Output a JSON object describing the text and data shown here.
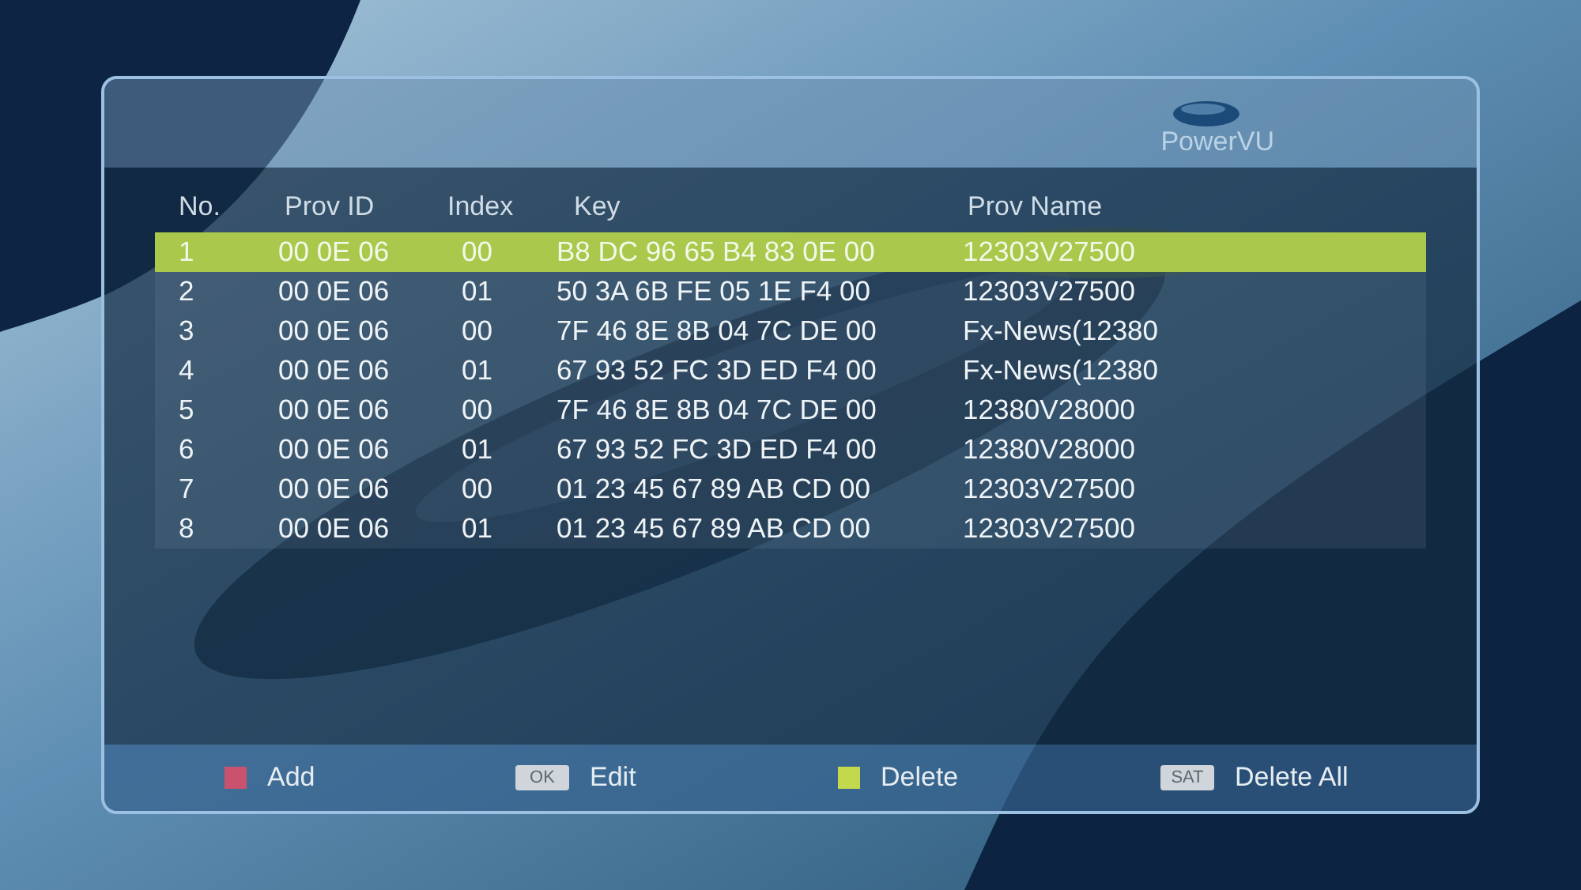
{
  "screen": {
    "title": "PowerVU"
  },
  "table": {
    "columns": [
      "No.",
      "Prov ID",
      "Index",
      "Key",
      "Prov Name"
    ],
    "rows": [
      {
        "no": "1",
        "prov_id": "00 0E 06",
        "index": "00",
        "key": "B8 DC 96 65 B4 83 0E 00",
        "prov_name": "12303V27500",
        "selected": true
      },
      {
        "no": "2",
        "prov_id": "00 0E 06",
        "index": "01",
        "key": "50 3A 6B FE 05 1E F4 00",
        "prov_name": "12303V27500",
        "selected": false
      },
      {
        "no": "3",
        "prov_id": "00 0E 06",
        "index": "00",
        "key": "7F 46 8E 8B 04 7C DE 00",
        "prov_name": "Fx-News(12380",
        "selected": false
      },
      {
        "no": "4",
        "prov_id": "00 0E 06",
        "index": "01",
        "key": "67 93 52 FC 3D ED F4 00",
        "prov_name": "Fx-News(12380",
        "selected": false
      },
      {
        "no": "5",
        "prov_id": "00 0E 06",
        "index": "00",
        "key": "7F 46 8E 8B 04 7C DE 00",
        "prov_name": "12380V28000",
        "selected": false
      },
      {
        "no": "6",
        "prov_id": "00 0E 06",
        "index": "01",
        "key": "67 93 52 FC 3D ED F4 00",
        "prov_name": "12380V28000",
        "selected": false
      },
      {
        "no": "7",
        "prov_id": "00 0E 06",
        "index": "00",
        "key": "01 23 45 67 89 AB CD 00",
        "prov_name": "12303V27500",
        "selected": false
      },
      {
        "no": "8",
        "prov_id": "00 0E 06",
        "index": "01",
        "key": "01 23 45 67 89 AB CD 00",
        "prov_name": "12303V27500",
        "selected": false
      }
    ]
  },
  "footer": {
    "legend": [
      {
        "kind": "color_key",
        "color": "#c9526e",
        "label": "Add"
      },
      {
        "kind": "badge_key",
        "badge": "OK",
        "label": "Edit"
      },
      {
        "kind": "color_key",
        "color": "#c4d84e",
        "label": "Delete"
      },
      {
        "kind": "badge_key",
        "badge": "SAT",
        "label": "Delete All"
      }
    ]
  }
}
